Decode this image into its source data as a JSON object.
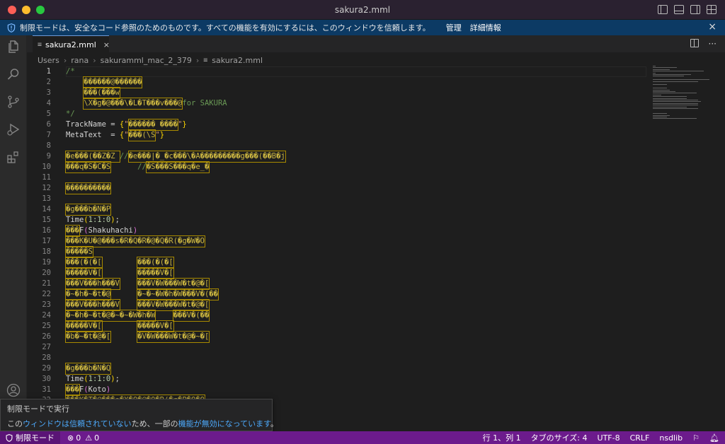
{
  "window": {
    "title": "sakura2.mml"
  },
  "banner": {
    "message": "制限モードは、安全なコード参照のためのものです。すべての機能を有効にするには、このウィンドウを信頼します。",
    "manage": "管理",
    "details": "詳細情報",
    "close": "×"
  },
  "tab": {
    "icon": "≡",
    "name": "sakura2.mml",
    "close": "×"
  },
  "tab_actions": {
    "more": "···"
  },
  "breadcrumb": [
    "Users",
    "rana",
    "sakuramml_mac_2_379",
    "sakura2.mml"
  ],
  "breadcrumb_file_icon": "≡",
  "editor": {
    "lines": [
      {
        "n": "1",
        "segments": [
          {
            "t": "/*",
            "c": "c-comment"
          }
        ]
      },
      {
        "n": "2",
        "segments": [
          {
            "t": "    ",
            "c": "c-plain"
          },
          {
            "t": "������@������",
            "c": "c-comment glyph"
          }
        ]
      },
      {
        "n": "3",
        "segments": [
          {
            "t": "    ",
            "c": "c-plain"
          },
          {
            "t": "���(���w",
            "c": "c-comment glyph"
          }
        ]
      },
      {
        "n": "4",
        "segments": [
          {
            "t": "    ",
            "c": "c-plain"
          },
          {
            "t": "\\X�g�@���\\�L�T���v���@",
            "c": "c-comment glyph"
          },
          {
            "t": "for SAKURA",
            "c": "c-comment"
          }
        ]
      },
      {
        "n": "5",
        "segments": [
          {
            "t": "*/",
            "c": "c-comment"
          }
        ]
      },
      {
        "n": "6",
        "segments": [
          {
            "t": "TrackName = ",
            "c": "c-plain"
          },
          {
            "t": "{",
            "c": "c-punc"
          },
          {
            "t": "\"",
            "c": "c-str"
          },
          {
            "t": "������ ����",
            "c": "c-str glyph"
          },
          {
            "t": "\"",
            "c": "c-str"
          },
          {
            "t": "}",
            "c": "c-punc"
          }
        ]
      },
      {
        "n": "7",
        "segments": [
          {
            "t": "MetaText  = ",
            "c": "c-plain"
          },
          {
            "t": "{",
            "c": "c-punc"
          },
          {
            "t": "\"",
            "c": "c-str"
          },
          {
            "t": "���(\\S",
            "c": "c-str glyph"
          },
          {
            "t": "\"",
            "c": "c-str"
          },
          {
            "t": "}",
            "c": "c-punc"
          }
        ]
      },
      {
        "n": "8",
        "segments": []
      },
      {
        "n": "9",
        "segments": [
          {
            "t": "�e���(��Z�Z ",
            "c": "c-plain glyph"
          },
          {
            "t": "//",
            "c": "c-comment"
          },
          {
            "t": "�e���|�_�c���\\�A���������g���(��B�j",
            "c": "c-comment glyph"
          }
        ]
      },
      {
        "n": "10",
        "segments": [
          {
            "t": "���q�S�C�S",
            "c": "c-plain glyph"
          },
          {
            "t": "      ",
            "c": "c-plain"
          },
          {
            "t": "//",
            "c": "c-comment"
          },
          {
            "t": "�S���S���q�e_�",
            "c": "c-comment glyph"
          }
        ]
      },
      {
        "n": "11",
        "segments": []
      },
      {
        "n": "12",
        "segments": [
          {
            "t": "����������",
            "c": "c-plain glyph"
          }
        ]
      },
      {
        "n": "13",
        "segments": []
      },
      {
        "n": "14",
        "segments": [
          {
            "t": "�g���b�N�P",
            "c": "c-plain glyph"
          }
        ]
      },
      {
        "n": "15",
        "segments": [
          {
            "t": "Time",
            "c": "c-plain"
          },
          {
            "t": "(",
            "c": "c-punc"
          },
          {
            "t": "1:1:0",
            "c": "c-num"
          },
          {
            "t": ")",
            "c": "c-punc"
          },
          {
            "t": ";",
            "c": "c-plain"
          }
        ]
      },
      {
        "n": "16",
        "segments": [
          {
            "t": "���",
            "c": "c-plain glyph"
          },
          {
            "t": "F",
            "c": "c-plain"
          },
          {
            "t": "(",
            "c": "c-paren"
          },
          {
            "t": "Shakuhachi",
            "c": "c-plain"
          },
          {
            "t": ")",
            "c": "c-paren"
          }
        ]
      },
      {
        "n": "17",
        "segments": [
          {
            "t": "���K�U�@���s�R�Q�R�@�Q�R(�g�W�O",
            "c": "c-plain glyph"
          }
        ]
      },
      {
        "n": "18",
        "segments": [
          {
            "t": "�����S",
            "c": "c-plain glyph"
          }
        ]
      },
      {
        "n": "19",
        "segments": [
          {
            "t": "���(�(�[",
            "c": "c-plain glyph"
          },
          {
            "t": "        ",
            "c": "c-plain"
          },
          {
            "t": "���(�(�[",
            "c": "c-plain glyph"
          }
        ]
      },
      {
        "n": "20",
        "segments": [
          {
            "t": "�����V�[",
            "c": "c-plain glyph"
          },
          {
            "t": "        ",
            "c": "c-plain"
          },
          {
            "t": "�����V�[",
            "c": "c-plain glyph"
          }
        ]
      },
      {
        "n": "21",
        "segments": [
          {
            "t": "���V���h���V",
            "c": "c-plain glyph"
          },
          {
            "t": "    ",
            "c": "c-plain"
          },
          {
            "t": "���V�W���W�t�@�[",
            "c": "c-plain glyph"
          }
        ]
      },
      {
        "n": "22",
        "segments": [
          {
            "t": "�~�h�~�t�@",
            "c": "c-plain glyph"
          },
          {
            "t": "      ",
            "c": "c-plain"
          },
          {
            "t": "�~�~�W�h�W���V�(��",
            "c": "c-plain glyph"
          }
        ]
      },
      {
        "n": "23",
        "segments": [
          {
            "t": "���V���h���V",
            "c": "c-plain glyph"
          },
          {
            "t": "    ",
            "c": "c-plain"
          },
          {
            "t": "���V�W���W�t�@�[",
            "c": "c-plain glyph"
          }
        ]
      },
      {
        "n": "24",
        "segments": [
          {
            "t": "�~�h�~�t�@�~�~�W�h�W",
            "c": "c-plain glyph"
          },
          {
            "t": "    ",
            "c": "c-plain"
          },
          {
            "t": "���V�(��",
            "c": "c-plain glyph"
          }
        ]
      },
      {
        "n": "25",
        "segments": [
          {
            "t": "�����V�[",
            "c": "c-plain glyph"
          },
          {
            "t": "        ",
            "c": "c-plain"
          },
          {
            "t": "�����V�[",
            "c": "c-plain glyph"
          }
        ]
      },
      {
        "n": "26",
        "segments": [
          {
            "t": "�b�~�t�@�[",
            "c": "c-plain glyph"
          },
          {
            "t": "      ",
            "c": "c-plain"
          },
          {
            "t": "�V�W���W�t�@�~�[",
            "c": "c-plain glyph"
          }
        ]
      },
      {
        "n": "27",
        "segments": []
      },
      {
        "n": "28",
        "segments": []
      },
      {
        "n": "29",
        "segments": [
          {
            "t": "�g���b�N�Q",
            "c": "c-plain glyph"
          }
        ]
      },
      {
        "n": "30",
        "segments": [
          {
            "t": "Time",
            "c": "c-plain"
          },
          {
            "t": "(",
            "c": "c-punc"
          },
          {
            "t": "1:1:0",
            "c": "c-num"
          },
          {
            "t": ")",
            "c": "c-punc"
          },
          {
            "t": ";",
            "c": "c-plain"
          }
        ]
      },
      {
        "n": "31",
        "segments": [
          {
            "t": "���",
            "c": "c-plain glyph"
          },
          {
            "t": "F",
            "c": "c-plain"
          },
          {
            "t": "(",
            "c": "c-paren"
          },
          {
            "t": "Koto",
            "c": "c-plain"
          },
          {
            "t": ")",
            "c": "c-paren"
          }
        ]
      },
      {
        "n": "32",
        "segments": [
          {
            "t": "���K�T�@���s�X�Q�@�Q�R(�g�P�O�O",
            "c": "c-plain glyph"
          }
        ]
      }
    ]
  },
  "popup": {
    "title": "制限モードで実行",
    "body_prefix": "この",
    "body_link1": "ウィンドウは信頼されていない",
    "body_mid": "ため、一部の",
    "body_link2": "機能が無効になっています",
    "body_suffix": "。"
  },
  "status": {
    "restricted": "制限モード",
    "errors": "0",
    "warnings": "0",
    "position": "行 1、列 1",
    "tab_size": "タブのサイズ: 4",
    "encoding": "UTF-8",
    "eol": "CRLF",
    "language": "nsdlib"
  },
  "colors": {
    "statusbar": "#6c1b8c",
    "banner": "#0c3a64",
    "editor_bg": "#1e1e1e"
  }
}
